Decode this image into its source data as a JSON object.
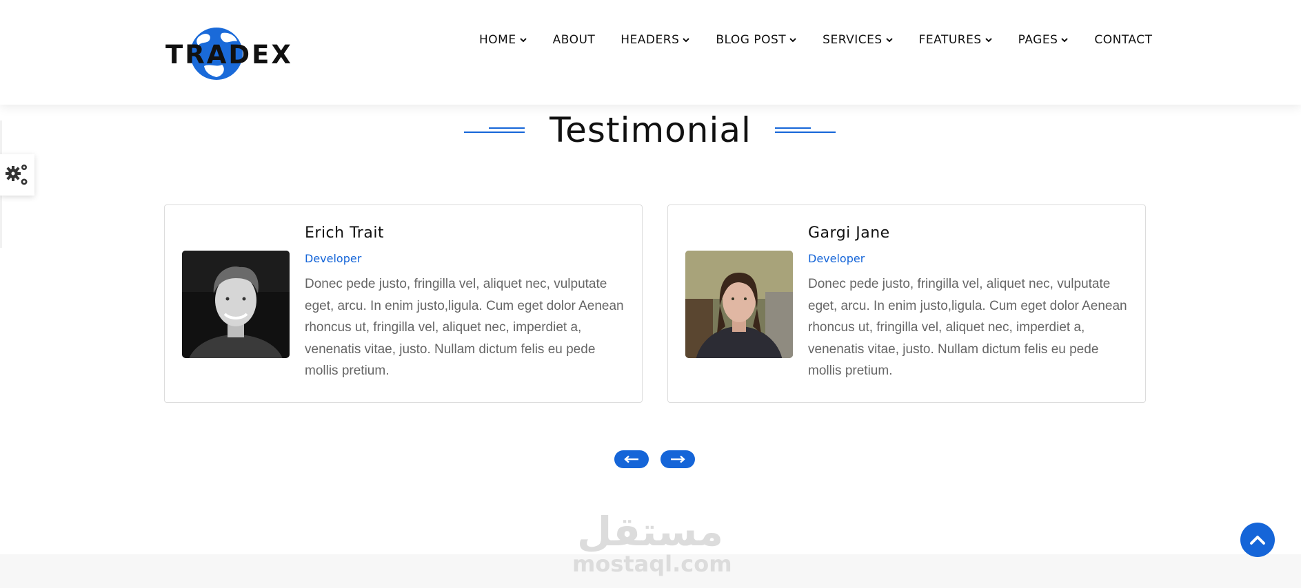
{
  "brand": {
    "logo_text": "TRADEX",
    "accent": "#1565d8"
  },
  "nav": {
    "items": [
      {
        "label": "HOME",
        "dropdown": true
      },
      {
        "label": "ABOUT",
        "dropdown": false
      },
      {
        "label": "HEADERS",
        "dropdown": true
      },
      {
        "label": "BLOG POST",
        "dropdown": true
      },
      {
        "label": "SERVICES",
        "dropdown": true
      },
      {
        "label": "FEATURES",
        "dropdown": true
      },
      {
        "label": "PAGES",
        "dropdown": true
      },
      {
        "label": "CONTACT",
        "dropdown": false
      }
    ]
  },
  "settings": {
    "icon": "gears-icon"
  },
  "section": {
    "title": "Testimonial"
  },
  "testimonials": [
    {
      "name": "Erich Trait",
      "role": "Developer",
      "quote": "Donec pede justo, fringilla vel, aliquet nec, vulputate eget, arcu. In enim justo,ligula. Cum eget dolor Aenean rhoncus ut, fringilla vel, aliquet nec, imperdiet a, venenatis vitae, justo. Nullam dictum felis eu pede mollis pretium."
    },
    {
      "name": "Gargi Jane",
      "role": "Developer",
      "quote": "Donec pede justo, fringilla vel, aliquet nec, vulputate eget, arcu. In enim justo,ligula. Cum eget dolor Aenean rhoncus ut, fringilla vel, aliquet nec, imperdiet a, venenatis vitae, justo. Nullam dictum felis eu pede mollis pretium."
    }
  ],
  "carousel": {
    "prev_icon": "arrow-left-icon",
    "next_icon": "arrow-right-icon"
  },
  "watermark": {
    "arabic": "مستقل",
    "latin": "mostaql.com"
  },
  "back_to_top": {
    "icon": "chevron-up-icon"
  }
}
